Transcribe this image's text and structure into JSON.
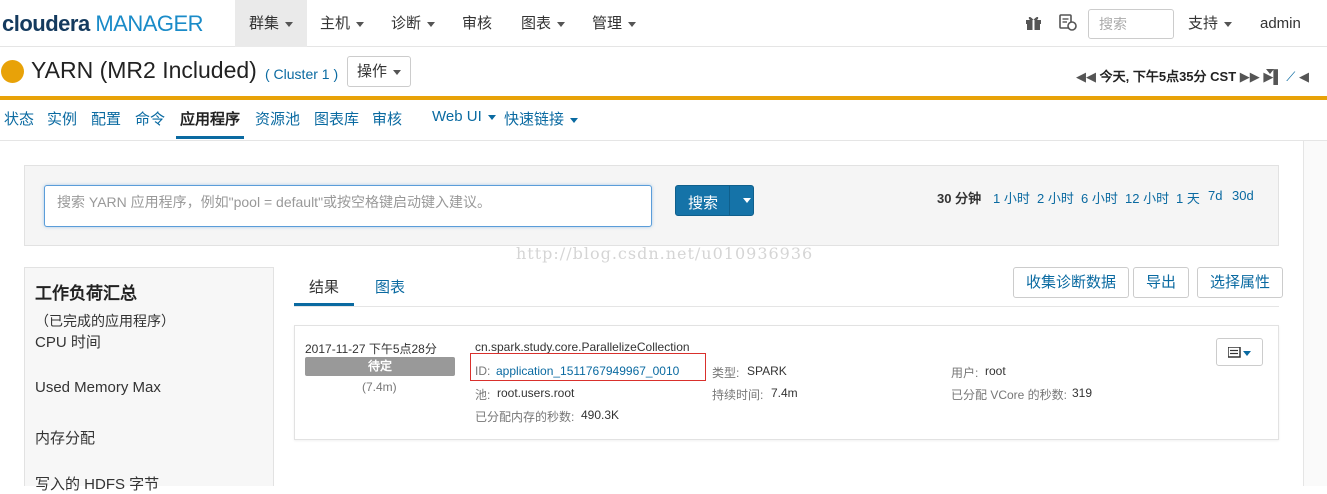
{
  "brand": {
    "part1": "cloudera",
    "part2": "MANAGER"
  },
  "topnav": {
    "items": [
      "群集",
      "主机",
      "诊断",
      "审核",
      "图表",
      "管理"
    ],
    "search_placeholder": "搜索",
    "support": "支持",
    "user": "admin"
  },
  "service": {
    "title": "YARN (MR2 Included)",
    "cluster": "( Cluster 1 )",
    "actions": "操作",
    "time": "今天, 下午5点35分 CST",
    "status_color": "#e8a208"
  },
  "subnav": {
    "items": [
      "状态",
      "实例",
      "配置",
      "命令",
      "应用程序",
      "资源池",
      "图表库",
      "审核",
      "Web UI",
      "快速链接"
    ],
    "active": "应用程序"
  },
  "search": {
    "placeholder": "搜索 YARN 应用程序，例如\"pool = default\"或按空格键启动键入建议。",
    "button": "搜索",
    "ranges": [
      "30 分钟",
      "1 小时",
      "2 小时",
      "6 小时",
      "12 小时",
      "1 天",
      "7d",
      "30d"
    ],
    "selected_range": "30 分钟"
  },
  "watermark": "http://blog.csdn.net/u010936936",
  "summary": {
    "title": "工作负荷汇总",
    "subtitle": "（已完成的应用程序）",
    "items": [
      "CPU 时间",
      "Used Memory Max",
      "内存分配",
      "写入的 HDFS 字节"
    ]
  },
  "tabs": [
    "结果",
    "图表"
  ],
  "actions": [
    "收集诊断数据",
    "导出",
    "选择属性"
  ],
  "app": {
    "time": "2017-11-27 下午5点28分",
    "state": "待定",
    "duration_short": "(7.4m)",
    "name": "cn.spark.study.core.ParallelizeCollection",
    "id_label": "ID:",
    "id": "application_1511767949967_0010",
    "type_label": "类型:",
    "type": "SPARK",
    "user_label": "用户:",
    "user": "root",
    "pool_label": "池:",
    "pool": "root.users.root",
    "duration_label": "持续时间:",
    "duration": "7.4m",
    "vcore_label": "已分配 VCore 的秒数:",
    "vcore": "319",
    "mem_label": "已分配内存的秒数:",
    "mem": "490.3K"
  }
}
